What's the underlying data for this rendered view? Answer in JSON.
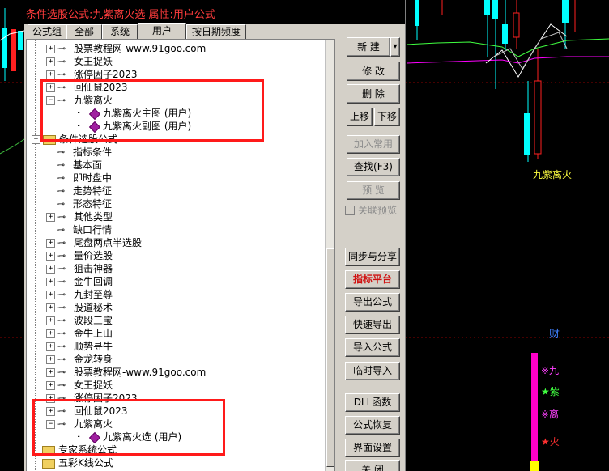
{
  "window": {
    "title": "条件选股公式:九紫离火选 属性:用户公式"
  },
  "tabs": [
    "公式组",
    "全部",
    "系统",
    "用户",
    "按日期频度"
  ],
  "active_tab": "用户",
  "tree_top": [
    "股票教程网-www.91goo.com",
    "女王捉妖",
    "涨停因子2023",
    "回仙鼠2023",
    "九紫离火",
    "九紫离火主图 (用户)",
    "九紫离火副图 (用户)",
    "条件选股公式"
  ],
  "tree_conditions": [
    "指标条件",
    "基本面",
    "即时盘中",
    "走势特征",
    "形态特征",
    "其他类型",
    "缺口行情",
    "尾盘两点半选股",
    "量价选股",
    "狙击神器",
    "金牛回调",
    "九封至尊",
    "股道秘术",
    "波段三宝",
    "金牛上山",
    "顺势寻牛",
    "金龙转身",
    "股票教程网-www.91goo.com",
    "女王捉妖",
    "涨停因子2023",
    "回仙鼠2023",
    "九紫离火",
    "九紫离火选 (用户)",
    "专家系统公式",
    "五彩K线公式"
  ],
  "buttons": {
    "new": "新 建",
    "modify": "修 改",
    "delete": "删 除",
    "move_up": "上移",
    "move_down": "下移",
    "add_common": "加入常用",
    "find": "查找(F3)",
    "preview": "预 览",
    "link_preview": "关联预览",
    "sync_share": "同步与分享",
    "indicator_platform": "指标平台",
    "export": "导出公式",
    "quick_export": "快速导出",
    "import": "导入公式",
    "temp_import": "临时导入",
    "dll": "DLL函数",
    "restore": "公式恢复",
    "ui_settings": "界面设置",
    "close": "关 闭"
  },
  "chart": {
    "indicator_name": "九紫离火",
    "caijin_label": "财",
    "side_marks": [
      "※九",
      "★紫",
      "※离",
      "★火"
    ]
  },
  "colors": {
    "up_candle": "#00ffff",
    "down_candle": "#ff2020",
    "accent_red": "#ff1a1a",
    "magenta_bar": "#ff00c8"
  }
}
